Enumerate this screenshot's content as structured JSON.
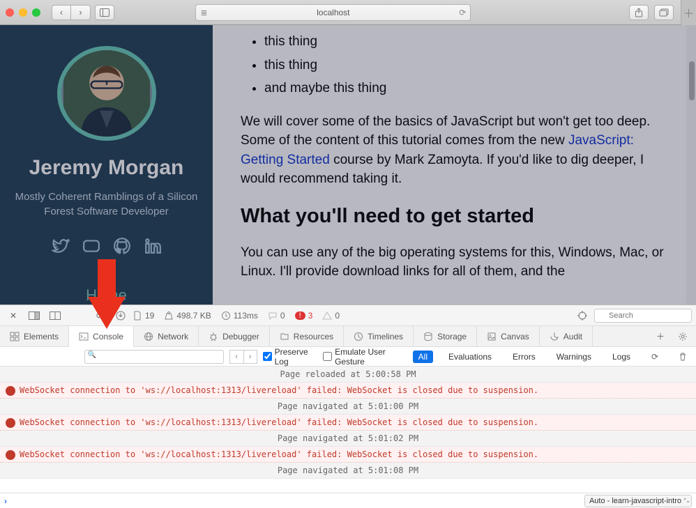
{
  "toolbar": {
    "address": "localhost"
  },
  "sidebar": {
    "name": "Jeremy Morgan",
    "tagline": "Mostly Coherent Ramblings of a Silicon Forest Software Developer",
    "home": "Home"
  },
  "article": {
    "bullets": [
      "this thing",
      "this thing",
      "and maybe this thing"
    ],
    "para1_a": "We will cover some of the basics of JavaScript but won't get too deep. Some of the content of this tutorial comes from the new ",
    "para1_link": "JavaScript: Getting Started",
    "para1_b": " course by Mark Zamoyta. If you'd like to dig deeper, I would recommend taking it.",
    "heading": "What you'll need to get started",
    "para2": "You can use any of the big operating systems for this, Windows, Mac, or Linux. I'll provide download links for all of them, and the"
  },
  "devtools": {
    "stats": {
      "resources": "19",
      "size": "498.7 KB",
      "time": "113ms",
      "logs": "0",
      "errors": "3",
      "warnings": "0"
    },
    "search_placeholder": "Search",
    "tabs": [
      "Elements",
      "Console",
      "Network",
      "Debugger",
      "Resources",
      "Timelines",
      "Storage",
      "Canvas",
      "Audit"
    ],
    "active_tab": "Console",
    "filter": {
      "preserve": "Preserve Log",
      "emulate": "Emulate User Gesture",
      "groups": [
        "All",
        "Evaluations",
        "Errors",
        "Warnings",
        "Logs"
      ],
      "active_group": "All"
    },
    "console_lines": [
      {
        "type": "info",
        "text": "Page reloaded at 5:00:58 PM"
      },
      {
        "type": "err",
        "text": "WebSocket connection to 'ws://localhost:1313/livereload' failed: WebSocket is closed due to suspension."
      },
      {
        "type": "info",
        "text": "Page navigated at 5:01:00 PM"
      },
      {
        "type": "err",
        "text": "WebSocket connection to 'ws://localhost:1313/livereload' failed: WebSocket is closed due to suspension."
      },
      {
        "type": "info",
        "text": "Page navigated at 5:01:02 PM"
      },
      {
        "type": "err",
        "text": "WebSocket connection to 'ws://localhost:1313/livereload' failed: WebSocket is closed due to suspension."
      },
      {
        "type": "info",
        "text": "Page navigated at 5:01:08 PM"
      }
    ],
    "context": "Auto - learn-javascript-intro"
  }
}
